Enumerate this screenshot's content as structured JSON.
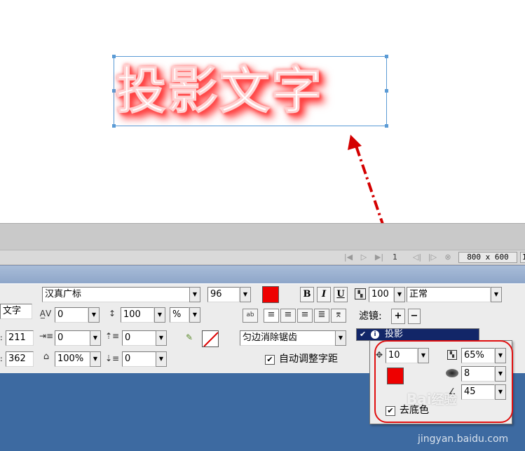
{
  "canvas": {
    "sample_text": "投影文字"
  },
  "timeline": {
    "frame_number": "1",
    "canvas_size": "800 x 600",
    "canvas_size_overflow": "1"
  },
  "text_props": {
    "font_name": "汉真广标",
    "font_size": "96",
    "text_color": "#ee0000",
    "bold_label": "B",
    "italic_label": "I",
    "underline_label": "U",
    "opacity": "100",
    "blend_mode": "正常",
    "layer_name": "文字",
    "kerning": "0",
    "leading": "100",
    "leading_unit": "%",
    "x": "211",
    "y": "362",
    "indent": "0",
    "space_before": "0",
    "horizontal_scale": "100%",
    "space_after": "0",
    "antialias": "匀边消除锯齿",
    "auto_kern_label": "自动调整字距",
    "auto_kern_checked": true,
    "filters_label": "滤镜:",
    "add_filter": "+",
    "remove_filter": "−"
  },
  "filters": {
    "active_filter": "投影",
    "distance": "10",
    "opacity": "65%",
    "softness": "8",
    "angle": "45",
    "shadow_color": "#ee0000",
    "knockout_label": "去底色",
    "knockout_checked": true
  },
  "watermark": {
    "logo": "Bai",
    "logo_suffix": "经验",
    "url": "jingyan.baidu.com"
  }
}
